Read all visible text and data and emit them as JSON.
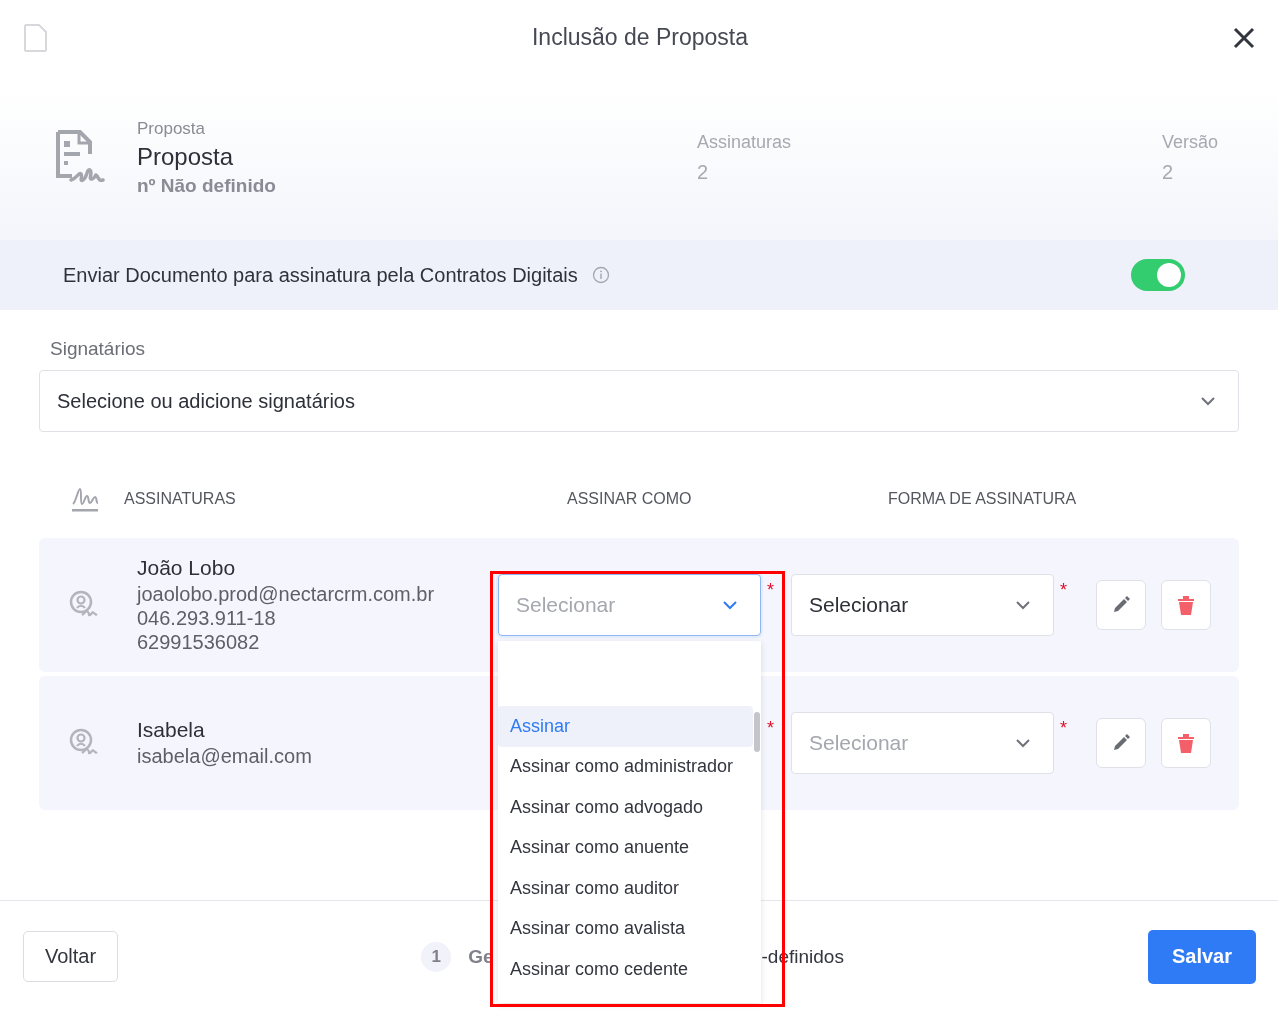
{
  "header": {
    "title": "Inclusão de Proposta"
  },
  "summary": {
    "type_label": "Proposta",
    "name": "Proposta",
    "number": "nº Não definido",
    "stats": [
      {
        "label": "Assinaturas",
        "value": "2"
      },
      {
        "label": "Versão",
        "value": "2"
      }
    ]
  },
  "send_toggle": {
    "label": "Enviar Documento para assinatura pela Contratos Digitais",
    "on": true
  },
  "signers_field": {
    "label": "Signatários",
    "placeholder": "Selecione ou adicione signatários"
  },
  "table": {
    "columns": [
      "ASSINATURAS",
      "ASSINAR COMO",
      "FORMA DE ASSINATURA"
    ],
    "rows": [
      {
        "name": "João Lobo",
        "details": [
          "joaolobo.prod@nectarcrm.com.br",
          "046.293.911-18",
          "62991536082"
        ],
        "sign_as": {
          "placeholder": "Selecionar",
          "open": true,
          "required_mark": "*"
        },
        "sign_method": {
          "value": "Selecionar",
          "required_mark": "*"
        }
      },
      {
        "name": "Isabela",
        "details": [
          "isabela@email.com"
        ],
        "sign_as": {
          "required_mark": "*"
        },
        "sign_method": {
          "placeholder": "Selecionar",
          "required_mark": "*"
        }
      }
    ]
  },
  "dropdown": {
    "options": [
      {
        "label": "Assinar",
        "selected": true
      },
      {
        "label": "Assinar como administrador",
        "selected": false
      },
      {
        "label": "Assinar como advogado",
        "selected": false
      },
      {
        "label": "Assinar como anuente",
        "selected": false
      },
      {
        "label": "Assinar como auditor",
        "selected": false
      },
      {
        "label": "Assinar como avalista",
        "selected": false
      },
      {
        "label": "Assinar como cedente",
        "selected": false
      }
    ]
  },
  "footer": {
    "back": "Voltar",
    "step": {
      "number": "1",
      "text_fragments": [
        "Ge",
        "-definidos"
      ]
    },
    "save": "Salvar"
  }
}
